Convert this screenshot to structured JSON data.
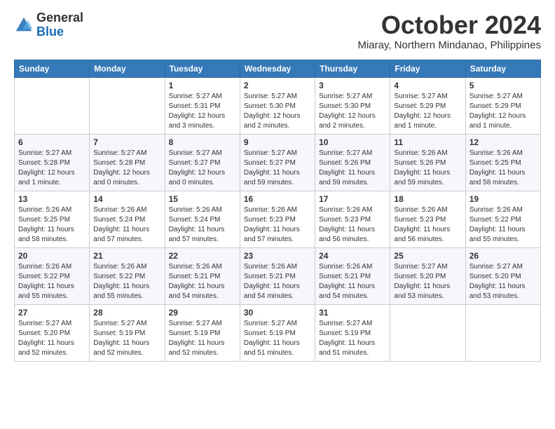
{
  "logo": {
    "general": "General",
    "blue": "Blue"
  },
  "title": {
    "month": "October 2024",
    "location": "Miaray, Northern Mindanao, Philippines"
  },
  "headers": [
    "Sunday",
    "Monday",
    "Tuesday",
    "Wednesday",
    "Thursday",
    "Friday",
    "Saturday"
  ],
  "weeks": [
    [
      {
        "date": "",
        "info": ""
      },
      {
        "date": "",
        "info": ""
      },
      {
        "date": "1",
        "info": "Sunrise: 5:27 AM\nSunset: 5:31 PM\nDaylight: 12 hours and 3 minutes."
      },
      {
        "date": "2",
        "info": "Sunrise: 5:27 AM\nSunset: 5:30 PM\nDaylight: 12 hours and 2 minutes."
      },
      {
        "date": "3",
        "info": "Sunrise: 5:27 AM\nSunset: 5:30 PM\nDaylight: 12 hours and 2 minutes."
      },
      {
        "date": "4",
        "info": "Sunrise: 5:27 AM\nSunset: 5:29 PM\nDaylight: 12 hours and 1 minute."
      },
      {
        "date": "5",
        "info": "Sunrise: 5:27 AM\nSunset: 5:29 PM\nDaylight: 12 hours and 1 minute."
      }
    ],
    [
      {
        "date": "6",
        "info": "Sunrise: 5:27 AM\nSunset: 5:28 PM\nDaylight: 12 hours and 1 minute."
      },
      {
        "date": "7",
        "info": "Sunrise: 5:27 AM\nSunset: 5:28 PM\nDaylight: 12 hours and 0 minutes."
      },
      {
        "date": "8",
        "info": "Sunrise: 5:27 AM\nSunset: 5:27 PM\nDaylight: 12 hours and 0 minutes."
      },
      {
        "date": "9",
        "info": "Sunrise: 5:27 AM\nSunset: 5:27 PM\nDaylight: 11 hours and 59 minutes."
      },
      {
        "date": "10",
        "info": "Sunrise: 5:27 AM\nSunset: 5:26 PM\nDaylight: 11 hours and 59 minutes."
      },
      {
        "date": "11",
        "info": "Sunrise: 5:26 AM\nSunset: 5:26 PM\nDaylight: 11 hours and 59 minutes."
      },
      {
        "date": "12",
        "info": "Sunrise: 5:26 AM\nSunset: 5:25 PM\nDaylight: 11 hours and 58 minutes."
      }
    ],
    [
      {
        "date": "13",
        "info": "Sunrise: 5:26 AM\nSunset: 5:25 PM\nDaylight: 11 hours and 58 minutes."
      },
      {
        "date": "14",
        "info": "Sunrise: 5:26 AM\nSunset: 5:24 PM\nDaylight: 11 hours and 57 minutes."
      },
      {
        "date": "15",
        "info": "Sunrise: 5:26 AM\nSunset: 5:24 PM\nDaylight: 11 hours and 57 minutes."
      },
      {
        "date": "16",
        "info": "Sunrise: 5:26 AM\nSunset: 5:23 PM\nDaylight: 11 hours and 57 minutes."
      },
      {
        "date": "17",
        "info": "Sunrise: 5:26 AM\nSunset: 5:23 PM\nDaylight: 11 hours and 56 minutes."
      },
      {
        "date": "18",
        "info": "Sunrise: 5:26 AM\nSunset: 5:23 PM\nDaylight: 11 hours and 56 minutes."
      },
      {
        "date": "19",
        "info": "Sunrise: 5:26 AM\nSunset: 5:22 PM\nDaylight: 11 hours and 55 minutes."
      }
    ],
    [
      {
        "date": "20",
        "info": "Sunrise: 5:26 AM\nSunset: 5:22 PM\nDaylight: 11 hours and 55 minutes."
      },
      {
        "date": "21",
        "info": "Sunrise: 5:26 AM\nSunset: 5:22 PM\nDaylight: 11 hours and 55 minutes."
      },
      {
        "date": "22",
        "info": "Sunrise: 5:26 AM\nSunset: 5:21 PM\nDaylight: 11 hours and 54 minutes."
      },
      {
        "date": "23",
        "info": "Sunrise: 5:26 AM\nSunset: 5:21 PM\nDaylight: 11 hours and 54 minutes."
      },
      {
        "date": "24",
        "info": "Sunrise: 5:26 AM\nSunset: 5:21 PM\nDaylight: 11 hours and 54 minutes."
      },
      {
        "date": "25",
        "info": "Sunrise: 5:27 AM\nSunset: 5:20 PM\nDaylight: 11 hours and 53 minutes."
      },
      {
        "date": "26",
        "info": "Sunrise: 5:27 AM\nSunset: 5:20 PM\nDaylight: 11 hours and 53 minutes."
      }
    ],
    [
      {
        "date": "27",
        "info": "Sunrise: 5:27 AM\nSunset: 5:20 PM\nDaylight: 11 hours and 52 minutes."
      },
      {
        "date": "28",
        "info": "Sunrise: 5:27 AM\nSunset: 5:19 PM\nDaylight: 11 hours and 52 minutes."
      },
      {
        "date": "29",
        "info": "Sunrise: 5:27 AM\nSunset: 5:19 PM\nDaylight: 11 hours and 52 minutes."
      },
      {
        "date": "30",
        "info": "Sunrise: 5:27 AM\nSunset: 5:19 PM\nDaylight: 11 hours and 51 minutes."
      },
      {
        "date": "31",
        "info": "Sunrise: 5:27 AM\nSunset: 5:19 PM\nDaylight: 11 hours and 51 minutes."
      },
      {
        "date": "",
        "info": ""
      },
      {
        "date": "",
        "info": ""
      }
    ]
  ]
}
